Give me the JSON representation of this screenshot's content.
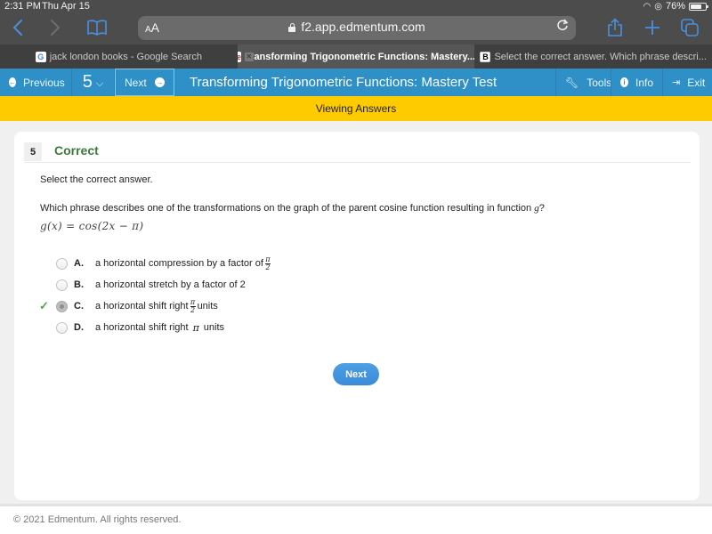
{
  "status_bar": {
    "time": "2:31 PM",
    "date": "Thu Apr 15",
    "battery_percent": "76%",
    "battery_level": 0.76
  },
  "browser": {
    "url": "f2.app.edmentum.com",
    "text_size_label": "AA",
    "tabs": [
      {
        "title": "jack london books - Google Search",
        "favicon": "google-icon",
        "active": false
      },
      {
        "title": "Transforming Trigonometric Functions: Mastery...",
        "favicon": "edmentum-icon",
        "active": true
      },
      {
        "title": "Select the correct answer. Which phrase descri...",
        "favicon": "brainly-icon",
        "active": false
      }
    ]
  },
  "header": {
    "previous_label": "Previous",
    "question_number": "5",
    "next_label": "Next",
    "title": "Transforming Trigonometric Functions: Mastery Test",
    "tools_label": "Tools",
    "info_label": "Info",
    "exit_label": "Exit",
    "accent_color": "#2f8fc7"
  },
  "banner": {
    "text": "Viewing Answers",
    "color": "#fecb00"
  },
  "question": {
    "number": "5",
    "status": "Correct",
    "status_color": "#3b7a3b",
    "instruction": "Select the correct answer.",
    "prompt": "Which phrase describes one of the transformations on the graph of the parent cosine function resulting in function",
    "prompt_var": "g",
    "prompt_end": "?",
    "formula": "g(x)  =  cos(2x − π)",
    "options": [
      {
        "letter": "A.",
        "text": "a horizontal compression by a factor of",
        "math": "π/2",
        "math_num": "π",
        "math_den": "2",
        "suffix": "",
        "selected": false,
        "correct": false
      },
      {
        "letter": "B.",
        "text": "a horizontal stretch by a factor of 2",
        "math": "",
        "suffix": "",
        "selected": false,
        "correct": false
      },
      {
        "letter": "C.",
        "text": "a horizontal shift right",
        "math": "π/2",
        "math_num": "π",
        "math_den": "2",
        "suffix": "units",
        "selected": true,
        "correct": true
      },
      {
        "letter": "D.",
        "text": "a horizontal shift right",
        "math": "π",
        "suffix": "units",
        "selected": false,
        "correct": false
      }
    ],
    "next_button": "Next"
  },
  "footer": {
    "copyright": "© 2021 Edmentum. All rights reserved."
  }
}
